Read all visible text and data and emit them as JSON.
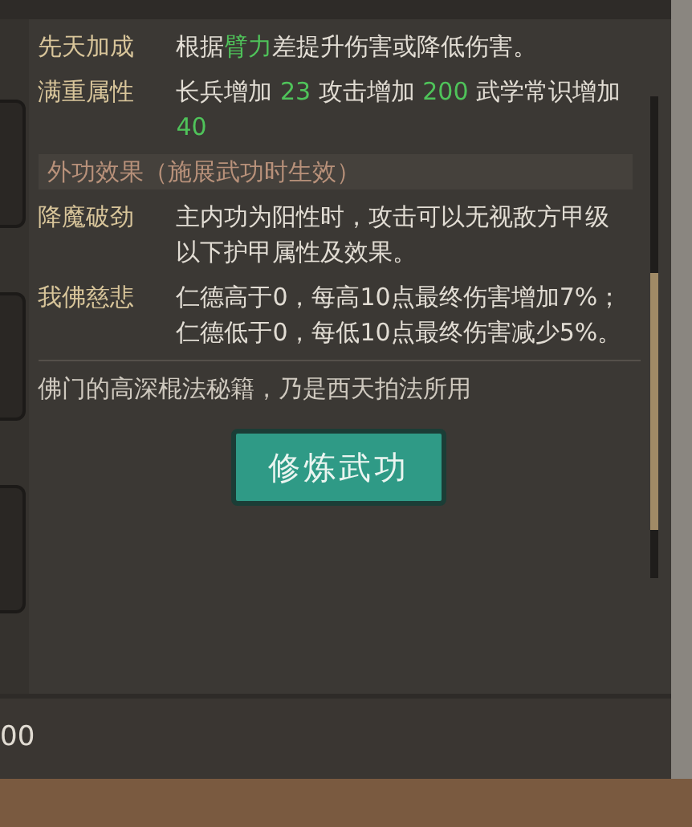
{
  "attributes": [
    {
      "label": "先天加成",
      "parts": [
        {
          "text": "根据",
          "highlight": false
        },
        {
          "text": "臂力",
          "highlight": true
        },
        {
          "text": "差提升伤害或降低伤害。",
          "highlight": false
        }
      ]
    },
    {
      "label": "满重属性",
      "parts": [
        {
          "text": "长兵增加 ",
          "highlight": false
        },
        {
          "text": "23",
          "highlight": true
        },
        {
          "text": " 攻击增加 ",
          "highlight": false
        },
        {
          "text": "200",
          "highlight": true
        },
        {
          "text": " 武学常识增加 ",
          "highlight": false
        },
        {
          "text": "40",
          "highlight": true
        }
      ]
    }
  ],
  "section_header": "外功效果（施展武功时生效）",
  "effects": [
    {
      "label": "降魔破劲",
      "text": "主内功为阳性时，攻击可以无视敌方甲级以下护甲属性及效果。"
    },
    {
      "label": "我佛慈悲",
      "text": "仁德高于0，每高10点最终伤害增加7%；仁德低于0，每低10点最终伤害减少5%。"
    }
  ],
  "description": "佛门的高深棍法秘籍，乃是西天拍法所用",
  "train_button": "修炼武功",
  "bottom_value": "00"
}
